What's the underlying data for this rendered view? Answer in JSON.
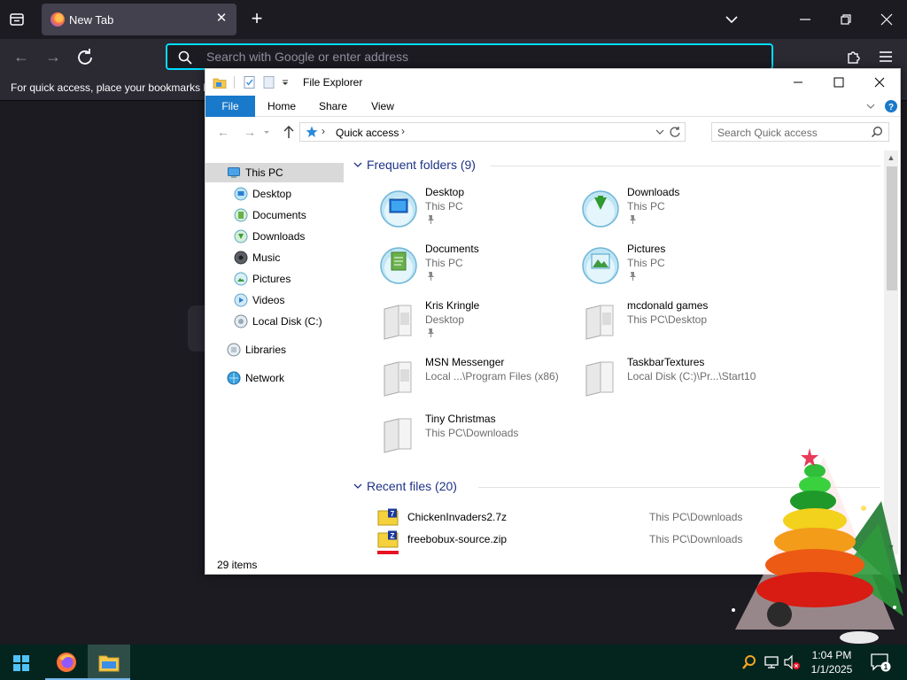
{
  "browser": {
    "tab_title": "New Tab",
    "url_placeholder": "Search with Google or enter address",
    "bookmarks_hint": "For quick access, place your bookmarks h"
  },
  "explorer": {
    "title": "File Explorer",
    "ribbon_tabs": [
      "File",
      "Home",
      "Share",
      "View"
    ],
    "address": {
      "crumb": "Quick access"
    },
    "search_placeholder": "Search Quick access",
    "nav": [
      {
        "label": "This PC",
        "icon": "computer-icon",
        "selected": true
      },
      {
        "label": "Desktop",
        "icon": "desktop-icon"
      },
      {
        "label": "Documents",
        "icon": "documents-icon"
      },
      {
        "label": "Downloads",
        "icon": "downloads-icon"
      },
      {
        "label": "Music",
        "icon": "music-icon"
      },
      {
        "label": "Pictures",
        "icon": "pictures-icon"
      },
      {
        "label": "Videos",
        "icon": "videos-icon"
      },
      {
        "label": "Local Disk (C:)",
        "icon": "drive-icon"
      },
      {
        "label": "Libraries",
        "icon": "libraries-icon"
      },
      {
        "label": "Network",
        "icon": "network-icon"
      }
    ],
    "frequent": {
      "header": "Frequent folders (9)",
      "items": [
        {
          "name": "Desktop",
          "location": "This PC",
          "icon": "desktop-icon"
        },
        {
          "name": "Downloads",
          "location": "This PC",
          "icon": "downloads-icon"
        },
        {
          "name": "Documents",
          "location": "This PC",
          "icon": "documents-icon"
        },
        {
          "name": "Pictures",
          "location": "This PC",
          "icon": "pictures-icon"
        },
        {
          "name": "Kris Kringle",
          "location": "Desktop",
          "icon": "folder-icon"
        },
        {
          "name": "mcdonald games",
          "location": "This PC\\Desktop",
          "icon": "folder-icon"
        },
        {
          "name": "MSN Messenger",
          "location": "Local ...\\Program Files (x86)",
          "icon": "folder-icon"
        },
        {
          "name": "TaskbarTextures",
          "location": "Local Disk (C:)\\Pr...\\Start10",
          "icon": "folder-icon"
        },
        {
          "name": "Tiny Christmas",
          "location": "This PC\\Downloads",
          "icon": "folder-icon"
        }
      ]
    },
    "recent": {
      "header": "Recent files (20)",
      "items": [
        {
          "name": "ChickenInvaders2.7z",
          "path": "This PC\\Downloads",
          "icon": "archive-7z-icon"
        },
        {
          "name": "freebobux-source.zip",
          "path": "This PC\\Downloads",
          "icon": "archive-zip-icon"
        }
      ]
    },
    "status": "29 items"
  },
  "taskbar": {
    "time": "1:04 PM",
    "date": "1/1/2025",
    "notifications": "1"
  },
  "colors": {
    "firefox_accent": "#00ddff",
    "explorer_file_tab": "#1979ca",
    "group_header": "#1e3287",
    "taskbar_bg": "#04241e"
  }
}
